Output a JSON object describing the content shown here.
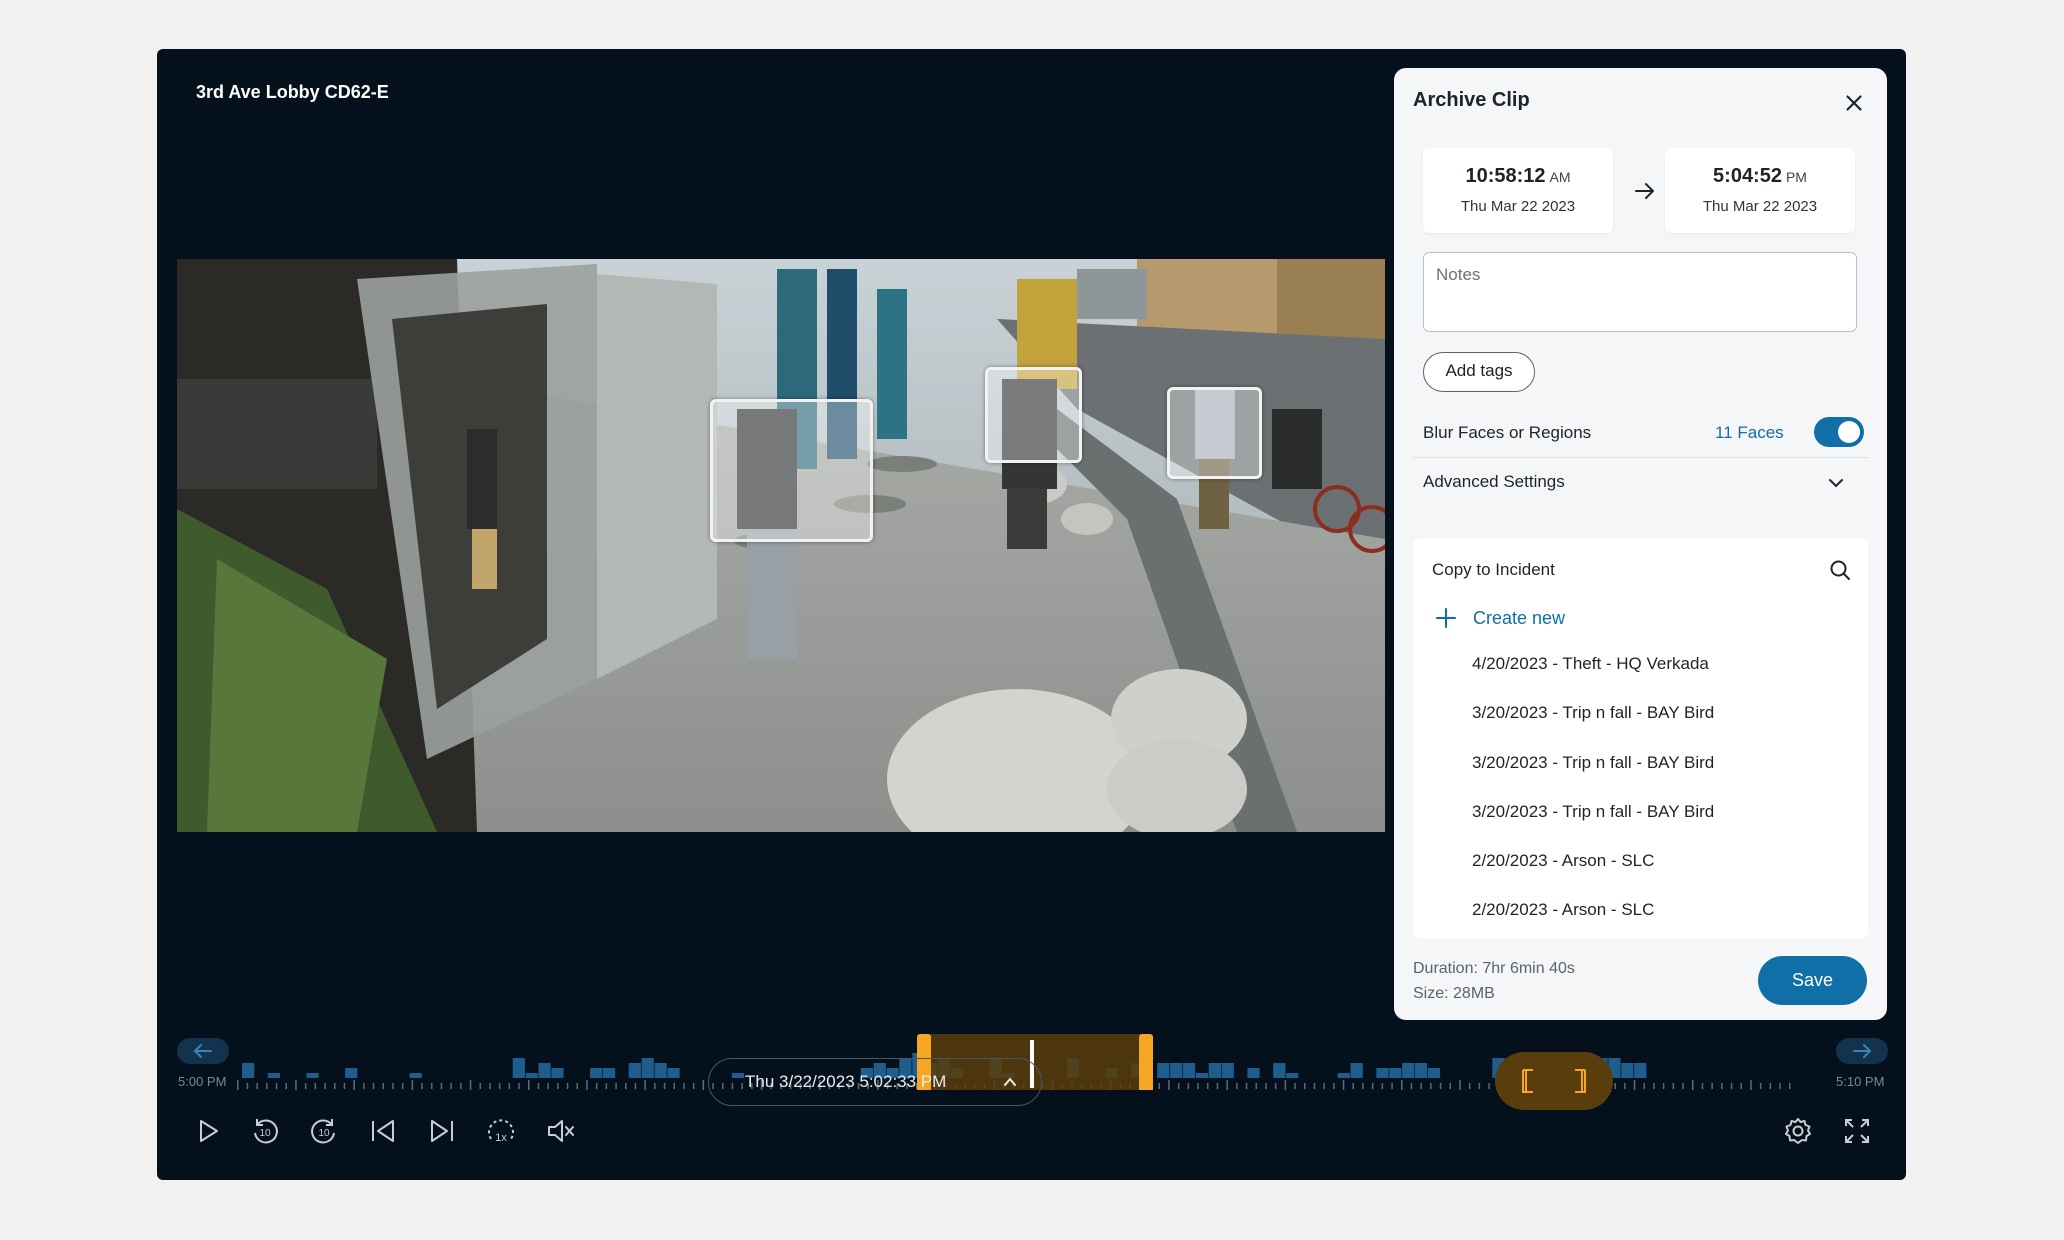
{
  "camera": {
    "name": "3rd Ave Lobby CD62-E"
  },
  "archive_panel": {
    "title": "Archive Clip",
    "start": {
      "time": "10:58:12",
      "ampm": "AM",
      "date": "Thu Mar 22 2023"
    },
    "end": {
      "time": "5:04:52",
      "ampm": "PM",
      "date": "Thu Mar 22 2023"
    },
    "notes_placeholder": "Notes",
    "add_tags_label": "Add tags",
    "blur_label": "Blur Faces or Regions",
    "faces_count": "11 Faces",
    "blur_enabled": true,
    "advanced_label": "Advanced Settings",
    "incident": {
      "title": "Copy to Incident",
      "create_label": "Create new",
      "items": [
        "4/20/2023 - Theft - HQ Verkada",
        "3/20/2023 - Trip n fall - BAY Bird",
        "3/20/2023 - Trip n fall - BAY Bird",
        "3/20/2023 - Trip n fall - BAY Bird",
        "2/20/2023 - Arson - SLC",
        "2/20/2023 - Arson - SLC"
      ]
    },
    "duration": "Duration: 7hr 6min 40s",
    "size": "Size: 28MB",
    "save_label": "Save"
  },
  "timeline": {
    "start_label": "5:00 PM",
    "end_label": "5:10 PM",
    "current_date": "Thu  3/22/2023  5:02:33 PM"
  },
  "controls": {
    "play_icon": "play-icon",
    "rewind_label": "10",
    "forward_label": "10",
    "speed_label": "1x"
  },
  "colors": {
    "app_bg": "#04111c",
    "accent_blue": "#0f6fa6",
    "selection_orange": "#f6a623",
    "activity_bar": "#1e5d8c"
  }
}
